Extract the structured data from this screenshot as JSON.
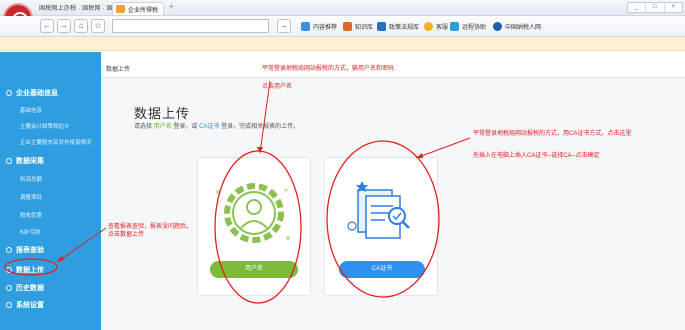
{
  "browser": {
    "brand_text": "国税网上办税 · 国税网 · 国税网",
    "tab_label": "企业所得税",
    "tab_new": "+",
    "window_buttons": [
      "_",
      "□",
      "×"
    ],
    "nav": {
      "back": "←",
      "forward": "→",
      "up": "⌂",
      "star": "☆",
      "go": "→"
    },
    "address_value": "",
    "bookmarks": [
      "内容推荐",
      "知识库",
      "政策法规库",
      "客服",
      "远程协助",
      "中国纳税人网"
    ]
  },
  "sidebar": {
    "sections": [
      {
        "title": "企业基础信息",
        "items": [
          "基础信息",
          "主要会计政策和估计",
          "企业主要股东及对外投资情况"
        ]
      },
      {
        "title": "数据采集",
        "items": [
          "利润总额",
          "调整项目",
          "税收优惠",
          "B补亏损"
        ]
      },
      {
        "title": "报表查验",
        "items": []
      },
      {
        "title": "数据上传",
        "items": []
      },
      {
        "title": "历史数据",
        "items": []
      },
      {
        "title": "系统设置",
        "items": []
      }
    ]
  },
  "main": {
    "breadcrumb": "数据上传",
    "title": "数据上传",
    "lead_prefix": "请选择",
    "lead_user": "用户名",
    "lead_mid": "登录，或",
    "lead_ca": "CA证书",
    "lead_suffix": "登录，完成相关报表的上传。",
    "user_button": "用户名",
    "ca_button": "CA证书"
  },
  "annotations": {
    "top": "平常登录地税局网站报税的方式，输用户名和密码",
    "top_sub": "点击用户名",
    "right_1": "平常登录地税局网站报税的方式，用CA证书方式，点击这里",
    "right_2": "先插入在电脑上插入CA证书--选择CA--点击确定",
    "left_1": "查看报表查验，报表没问题后，",
    "left_2": "点击数据上传"
  },
  "colors": {
    "sidebar": "#2e9ee0",
    "user_green": "#7cbb3a",
    "ca_blue": "#2f8ff2",
    "annotation_red": "#e02020"
  }
}
